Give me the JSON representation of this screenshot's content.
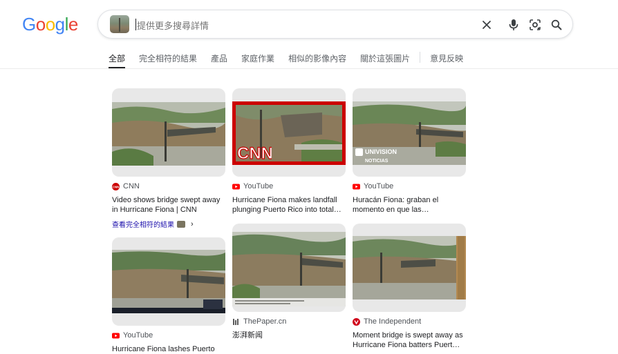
{
  "logo": {
    "letters": [
      "G",
      "o",
      "o",
      "g",
      "l",
      "e"
    ],
    "colors": [
      "#4285F4",
      "#EA4335",
      "#FBBC05",
      "#4285F4",
      "#34A853",
      "#EA4335"
    ]
  },
  "search": {
    "placeholder": "提供更多搜尋詳情",
    "value": ""
  },
  "search_icons": [
    "clear-icon",
    "mic-icon",
    "lens-icon",
    "search-icon"
  ],
  "tabs": [
    {
      "label": "全部",
      "active": true
    },
    {
      "label": "完全相符的結果"
    },
    {
      "label": "產品"
    },
    {
      "label": "家庭作業"
    },
    {
      "label": "相似的影像內容"
    },
    {
      "label": "關於這張圖片"
    },
    {
      "label": "意見反映"
    }
  ],
  "results": [
    {
      "source": "CNN",
      "favicon": "cnn-icon",
      "title": "Video shows bridge swept away in Hurricane Fiona | CNN",
      "more_label": "查看完全相符的結果",
      "overlay": "CNN"
    },
    {
      "source": "YouTube",
      "favicon": "youtube-icon",
      "title": "Hurricane Fiona makes landfall plunging Puerto Rico into total…"
    },
    {
      "source": "YouTube",
      "favicon": "youtube-icon",
      "title": "Huracán Fiona: graban el momento en que las…",
      "overlay_line1": "UNIVISION",
      "overlay_line2": "NOTICIAS"
    },
    {
      "source": "YouTube",
      "favicon": "youtube-icon",
      "title": "Hurricane Fiona lashes Puerto"
    },
    {
      "source": "ThePaper.cn",
      "favicon": "thepaper-icon",
      "title": "澎湃新闻"
    },
    {
      "source": "The Independent",
      "favicon": "independent-icon",
      "title": "Moment bridge is swept away as Hurricane Fiona batters Puert…"
    }
  ],
  "colors": {
    "youtube": "#FF0000",
    "cnn": "#CC0000",
    "link": "#1a0dab"
  }
}
